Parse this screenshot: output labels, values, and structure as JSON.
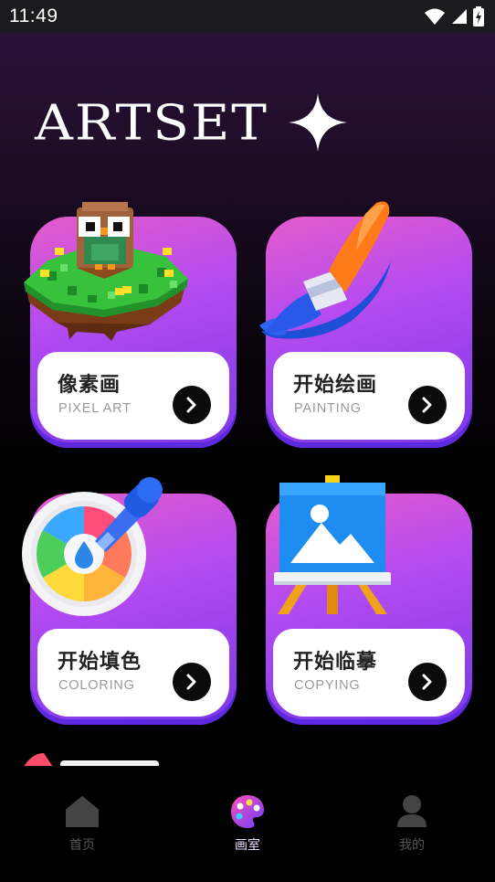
{
  "status_bar": {
    "time": "11:49"
  },
  "brand": {
    "title": "ARTSET"
  },
  "cards": [
    {
      "title": "像素画",
      "subtitle": "PIXEL ART",
      "art_icon": "pixel-island-icon"
    },
    {
      "title": "开始绘画",
      "subtitle": "PAINTING",
      "art_icon": "paintbrush-icon"
    },
    {
      "title": "开始填色",
      "subtitle": "COLORING",
      "art_icon": "color-wheel-dropper-icon"
    },
    {
      "title": "开始临摹",
      "subtitle": "COPYING",
      "art_icon": "easel-picture-icon"
    }
  ],
  "tabs": [
    {
      "label": "首页",
      "icon": "home-icon",
      "active": false
    },
    {
      "label": "画室",
      "icon": "palette-icon",
      "active": true
    },
    {
      "label": "我的",
      "icon": "user-icon",
      "active": false
    }
  ],
  "colors": {
    "card_gradient_top": "#e45bcb",
    "card_gradient_bottom": "#7a37e8",
    "active_tab": "#e9d9ff",
    "inactive_tab": "#555555"
  }
}
